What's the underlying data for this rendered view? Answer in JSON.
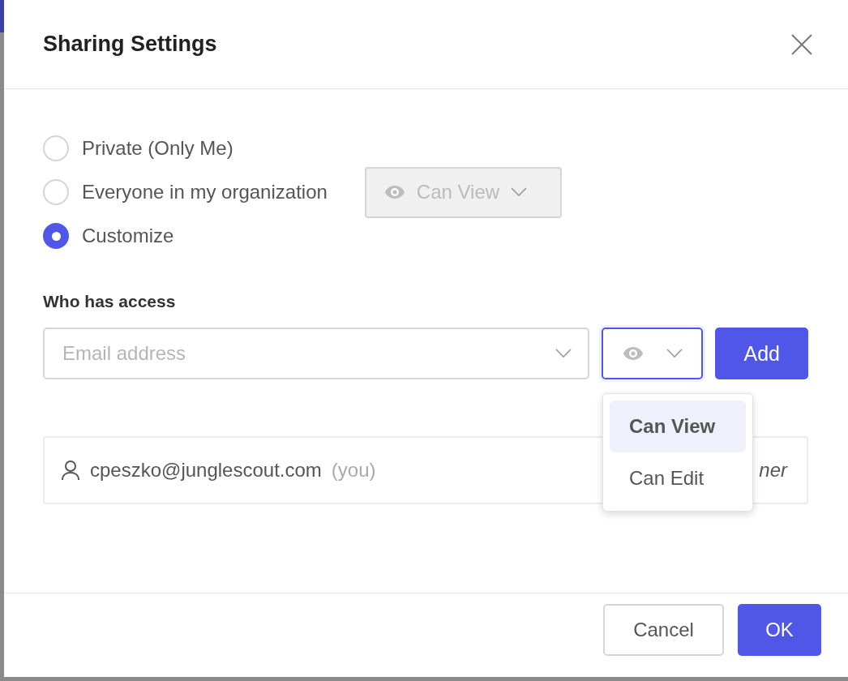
{
  "dialog": {
    "title": "Sharing Settings"
  },
  "visibility_options": [
    {
      "label": "Private (Only Me)",
      "selected": false
    },
    {
      "label": "Everyone in my organization",
      "selected": false
    },
    {
      "label": "Customize",
      "selected": true
    }
  ],
  "org_permission": {
    "value": "Can View",
    "disabled": true
  },
  "access": {
    "label": "Who has access",
    "email_placeholder": "Email address",
    "add_button": "Add",
    "permission_menu": {
      "expanded": true,
      "options": [
        {
          "label": "Can View",
          "selected": true
        },
        {
          "label": "Can Edit",
          "selected": false
        }
      ]
    }
  },
  "members": [
    {
      "email": "cpeszko@junglescout.com",
      "note": "(you)",
      "role": "ner"
    }
  ],
  "buttons": [
    {
      "label": "Cancel",
      "kind": "secondary"
    },
    {
      "label": "OK",
      "kind": "primary"
    }
  ]
}
